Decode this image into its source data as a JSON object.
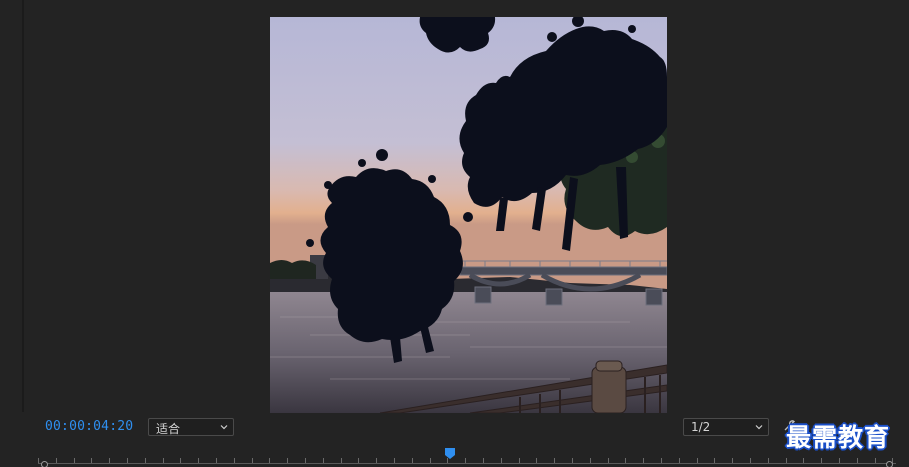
{
  "program_monitor": {
    "timecode": "00:00:04:20",
    "zoom_select": {
      "value": "适合"
    },
    "resolution_select": {
      "value": "1/2"
    },
    "playhead_position": 0.48
  },
  "watermark": {
    "text": "最需教育"
  },
  "colors": {
    "timecode": "#2f8ff0",
    "playhead": "#2f8ff0",
    "panel_bg": "#232323",
    "ink_splash": "#0c0f1c"
  },
  "icons": {
    "settings": "wrench-icon",
    "dropdown": "chevron-down-icon",
    "playhead": "playhead-icon"
  }
}
